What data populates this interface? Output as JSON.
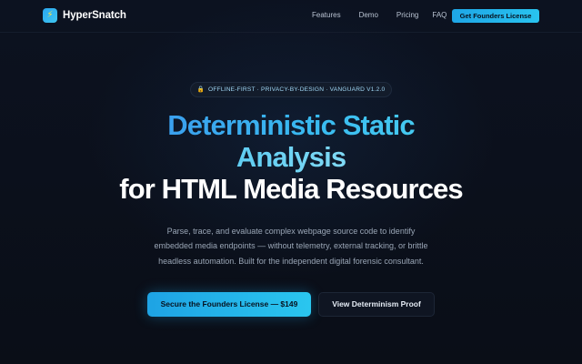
{
  "brand": {
    "icon": "lightning-bolt-icon",
    "icon_glyph": "⚡",
    "name": "HyperSnatch"
  },
  "nav": {
    "links": [
      "Features",
      "Demo",
      "Pricing",
      "FAQ"
    ],
    "cta_label": "Get Founders License"
  },
  "hero": {
    "badge": {
      "icon": "lock-icon",
      "icon_glyph": "🔒",
      "text": "OFFLINE-FIRST · PRIVACY-BY-DESIGN · VANGUARD V1.2.0"
    },
    "title_line1": "Deterministic Static",
    "title_line2": "Analysis",
    "title_line3": "for HTML Media Resources",
    "description": "Parse, trace, and evaluate complex webpage source code to identify embedded media endpoints — without telemetry, external tracking, or brittle headless automation. Built for the independent digital forensic consultant.",
    "primary_button": "Secure the Founders License — $149",
    "secondary_button": "View Determinism Proof"
  },
  "colors": {
    "background": "#0b0f19",
    "accent": "#1ea6e6",
    "accent_light": "#45c9f0"
  }
}
